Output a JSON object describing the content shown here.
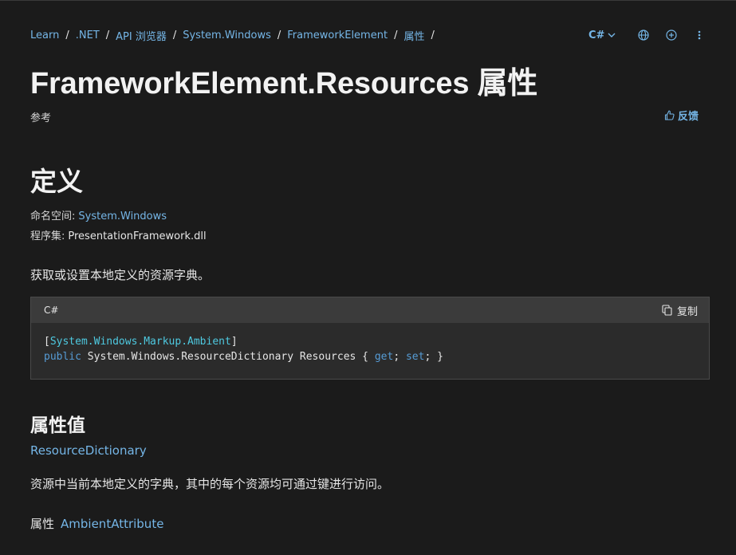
{
  "breadcrumb": [
    "Learn",
    ".NET",
    "API 浏览器",
    "System.Windows",
    "FrameworkElement",
    "属性"
  ],
  "breadcrumb_separator": "/",
  "lang_selector": "C#",
  "page_title": "FrameworkElement.Resources 属性",
  "page_type": "参考",
  "feedback_label": "反馈",
  "definition": {
    "heading": "定义",
    "namespace_label": "命名空间:",
    "namespace_value": "System.Windows",
    "assembly_label": "程序集:",
    "assembly_value": "PresentationFramework.dll"
  },
  "summary": "获取或设置本地定义的资源字典。",
  "code": {
    "language": "C#",
    "copy_label": "复制",
    "line1_bracket_open": "[",
    "line1_attr": "System.Windows.Markup.Ambient",
    "line1_bracket_close": "]",
    "line2_public": "public",
    "line2_type": " System.Windows.ResourceDictionary Resources { ",
    "line2_get": "get",
    "line2_mid": "; ",
    "line2_set": "set",
    "line2_end": "; }"
  },
  "property_value": {
    "heading": "属性值",
    "type_link": "ResourceDictionary",
    "description": "资源中当前本地定义的字典，其中的每个资源均可通过键进行访问。",
    "attributes_label": "属性",
    "attributes_value": "AmbientAttribute"
  },
  "icons": {
    "globe": "globe-icon",
    "add": "add-circle-icon",
    "more": "more-vertical-icon",
    "feedback": "thumbs-up-icon",
    "copy": "copy-icon",
    "chevron": "chevron-down-icon"
  }
}
